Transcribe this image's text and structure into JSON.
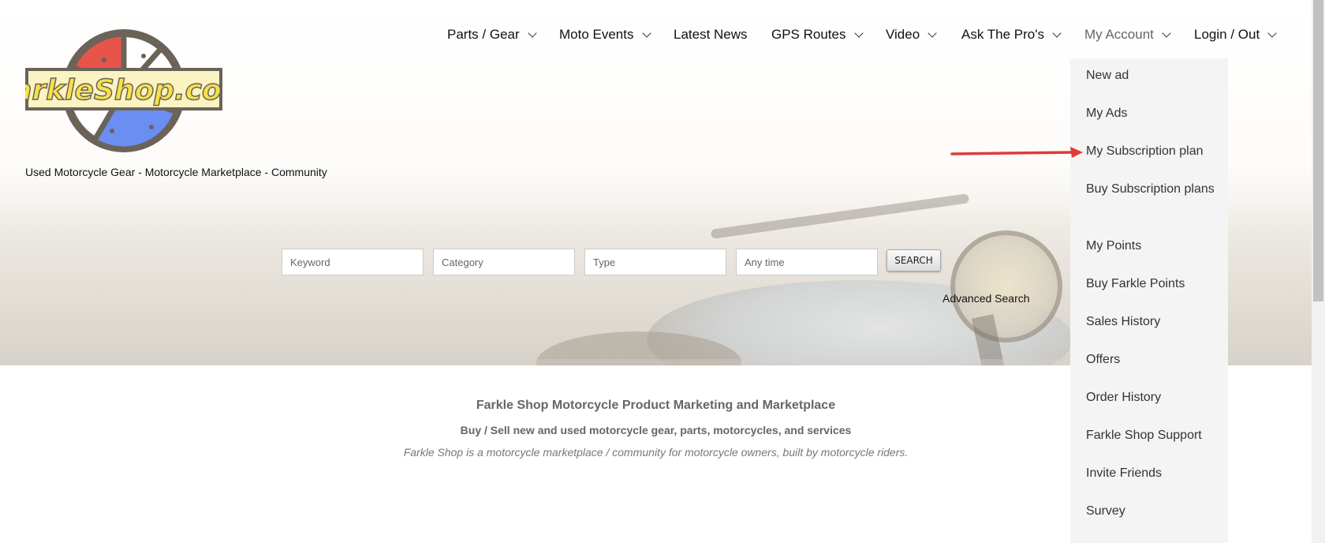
{
  "logo": {
    "text": "FarkleShop.com"
  },
  "tagline": "Used Motorcycle Gear - Motorcycle Marketplace - Community",
  "nav": [
    {
      "label": "Parts / Gear",
      "dropdown": true
    },
    {
      "label": "Moto Events",
      "dropdown": true
    },
    {
      "label": "Latest News",
      "dropdown": false
    },
    {
      "label": "GPS Routes",
      "dropdown": true
    },
    {
      "label": "Video",
      "dropdown": true
    },
    {
      "label": "Ask The Pro's",
      "dropdown": true
    },
    {
      "label": "My Account",
      "dropdown": true,
      "active": true
    },
    {
      "label": "Login / Out",
      "dropdown": true
    }
  ],
  "account_menu": [
    "New ad",
    "My Ads",
    "My Subscription plan",
    "Buy Subscription plans",
    "My Points",
    "Buy Farkle Points",
    "Sales History",
    "Offers",
    "Order History",
    "Farkle Shop Support",
    "Invite Friends",
    "Survey"
  ],
  "search": {
    "keyword_placeholder": "Keyword",
    "category_placeholder": "Category",
    "type_placeholder": "Type",
    "time_placeholder": "Any time",
    "button": "SEARCH",
    "advanced": "Advanced Search"
  },
  "content": {
    "title": "Farkle Shop Motorcycle Product Marketing and Marketplace",
    "subtitle": "Buy / Sell new and used motorcycle gear, parts, motorcycles, and services",
    "description": "Farkle Shop is a motorcycle marketplace / community for motorcycle owners, built by motorcycle riders."
  },
  "colors": {
    "logo_red": "#e8544a",
    "logo_blue": "#6b8ef2",
    "logo_yellow": "#f6e14a",
    "logo_gray": "#6b6358",
    "arrow_red": "#e03a3a"
  },
  "annotation": {
    "icon": "red-arrow-icon",
    "points_to": "My Subscription plan"
  }
}
